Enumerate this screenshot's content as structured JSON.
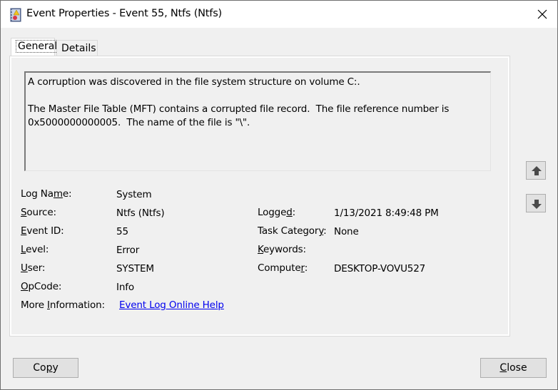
{
  "window": {
    "title": "Event Properties - Event 55, Ntfs (Ntfs)",
    "app_icon": "event-viewer-icon",
    "close_icon": "close-icon"
  },
  "tabs": [
    {
      "label": "General",
      "active": true
    },
    {
      "label": "Details",
      "active": false
    }
  ],
  "description": "A corruption was discovered in the file system structure on volume C:.\n\nThe Master File Table (MFT) contains a corrupted file record.  The file reference number is\n0x5000000000005.  The name of the file is \"\\\".",
  "fields_left": [
    {
      "label": "Log Name:",
      "value": "System"
    },
    {
      "label": "Source:",
      "value": "Ntfs (Ntfs)"
    },
    {
      "label": "Event ID:",
      "value": "55"
    },
    {
      "label": "Level:",
      "value": "Error"
    },
    {
      "label": "User:",
      "value": "SYSTEM"
    },
    {
      "label": "OpCode:",
      "value": "Info"
    },
    {
      "label": "More Information:",
      "value": "Event Log Online Help"
    }
  ],
  "fields_right": [
    {
      "label": "Logged:",
      "value": "1/13/2021 8:49:48 PM"
    },
    {
      "label": "Task Category:",
      "value": "None"
    },
    {
      "label": "Keywords:",
      "value": ""
    },
    {
      "label": "Computer:",
      "value": "DESKTOP-VOVU527"
    }
  ],
  "nav": {
    "up_icon": "arrow-up-icon",
    "down_icon": "arrow-down-icon"
  },
  "buttons": {
    "copy": "Copy",
    "close": "Close"
  }
}
